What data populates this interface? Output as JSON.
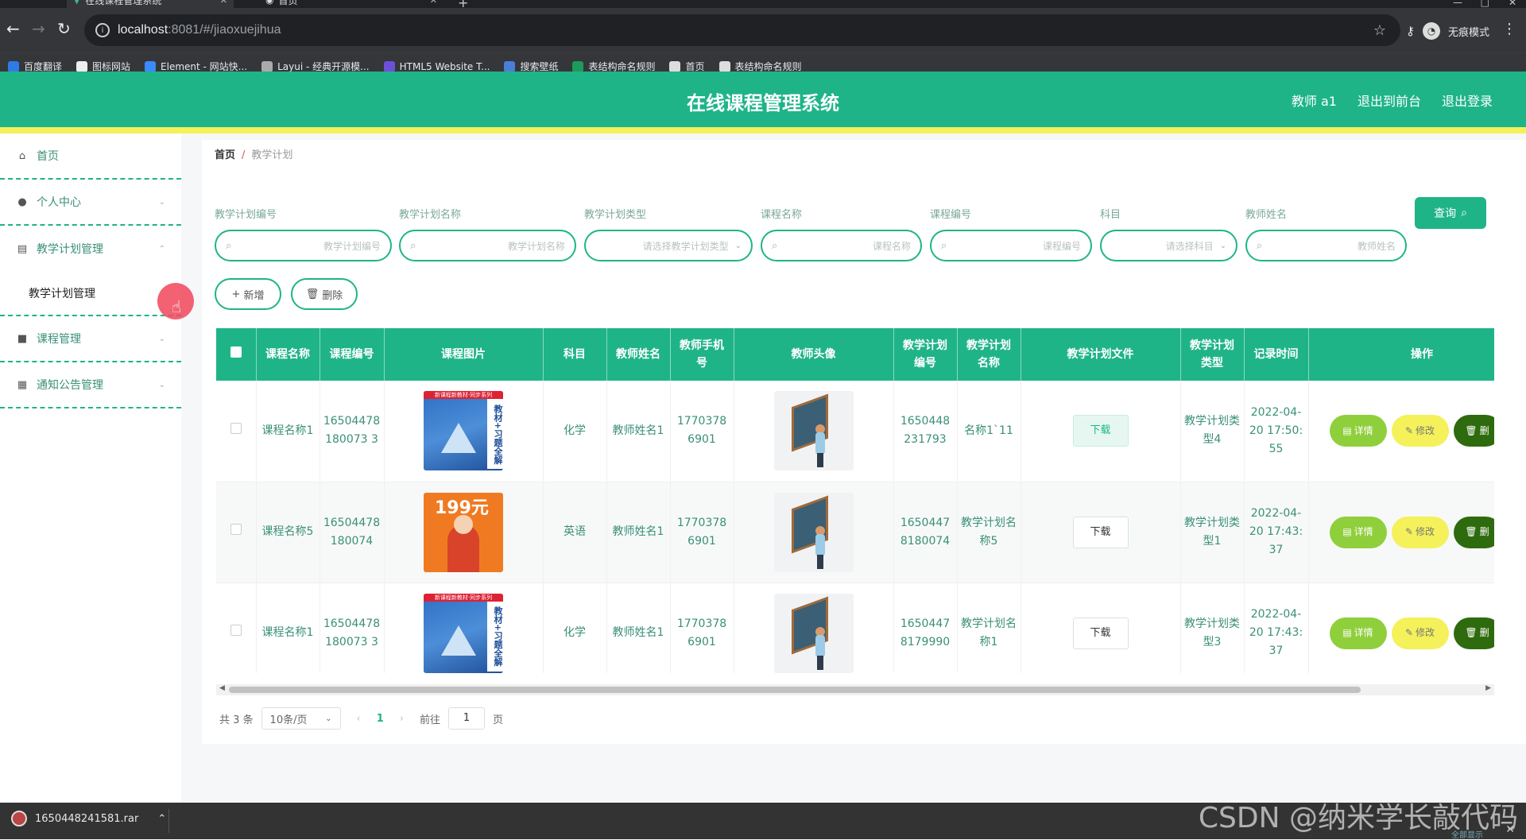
{
  "browser": {
    "tabs": [
      {
        "label": "在线课程管理系统",
        "close": "✕"
      },
      {
        "label": "首页",
        "close": "✕"
      }
    ],
    "url_host": "localhost",
    "url_rest": ":8081/#/jiaoxuejihua",
    "incognito_label": "无痕模式",
    "bookmarks": [
      {
        "label": "百度翻译",
        "color": "#2e7be8"
      },
      {
        "label": "图标网站",
        "color": "#eee"
      },
      {
        "label": "Element - 网站快...",
        "color": "#3b8bff"
      },
      {
        "label": "Layui - 经典开源模...",
        "color": "#aaa"
      },
      {
        "label": "HTML5 Website T...",
        "color": "#6e4fd8"
      },
      {
        "label": "搜索壁纸",
        "color": "#4a7fd8"
      },
      {
        "label": "表结构命名规则",
        "color": "#1d9b5b"
      },
      {
        "label": "首页",
        "color": "#ddd"
      },
      {
        "label": "表结构命名规则",
        "color": "#ddd"
      }
    ]
  },
  "header": {
    "title": "在线课程管理系统",
    "user": "教师 a1",
    "back_front": "退出到前台",
    "logout": "退出登录"
  },
  "sidebar": {
    "items": [
      {
        "label": "首页",
        "icon": "home-icon"
      },
      {
        "label": "个人中心",
        "icon": "user-icon"
      },
      {
        "label": "教学计划管理",
        "icon": "document-icon"
      },
      {
        "label": "课程管理",
        "icon": "video-icon"
      },
      {
        "label": "通知公告管理",
        "icon": "grid-icon"
      }
    ],
    "sub_item": "教学计划管理"
  },
  "breadcrumb": {
    "home": "首页",
    "sep": "/",
    "current": "教学计划"
  },
  "filters": [
    {
      "label": "教学计划编号",
      "placeholder": "教学计划编号"
    },
    {
      "label": "教学计划名称",
      "placeholder": "教学计划名称"
    },
    {
      "label": "教学计划类型",
      "placeholder": "请选择教学计划类型"
    },
    {
      "label": "课程名称",
      "placeholder": "课程名称"
    },
    {
      "label": "课程编号",
      "placeholder": "课程编号"
    },
    {
      "label": "科目",
      "placeholder": "请选择科目"
    },
    {
      "label": "教师姓名",
      "placeholder": "教师姓名"
    }
  ],
  "buttons": {
    "query": "查询",
    "add": "新增",
    "delete": "删除"
  },
  "table": {
    "headers": [
      "课程名称",
      "课程编号",
      "课程图片",
      "科目",
      "教师姓名",
      "教师手机号",
      "教师头像",
      "教学计划编号",
      "教学计划名称",
      "教学计划文件",
      "教学计划类型",
      "记录时间",
      "操作"
    ],
    "rows": [
      {
        "course_name": "课程名称1",
        "course_no": "16504478180073 3",
        "image": "book",
        "subject": "化学",
        "teacher": "教师姓名1",
        "phone": "17703786901",
        "plan_no": "1650448231793",
        "plan_name": "名称1`11",
        "file": "下载",
        "plan_type": "教学计划类型4",
        "time": "2022-04-20 17:50:55"
      },
      {
        "course_name": "课程名称5",
        "course_no": "16504478180074",
        "image": "orange",
        "subject": "英语",
        "teacher": "教师姓名1",
        "phone": "17703786901",
        "plan_no": "16504478180074",
        "plan_name": "教学计划名称5",
        "file": "下载",
        "plan_type": "教学计划类型1",
        "time": "2022-04-20 17:43:37"
      },
      {
        "course_name": "课程名称1",
        "course_no": "16504478180073 3",
        "image": "book",
        "subject": "化学",
        "teacher": "教师姓名1",
        "phone": "17703786901",
        "plan_no": "16504478179990",
        "plan_name": "教学计划名称1",
        "file": "下载",
        "plan_type": "教学计划类型3",
        "time": "2022-04-20 17:43:37"
      }
    ],
    "ops": {
      "detail": "详情",
      "edit": "修改",
      "delete": "删"
    }
  },
  "book_cover": {
    "top": "新课程新教材·同步系列",
    "spine": "教材+习题全解",
    "orange_title": "199元"
  },
  "pagination": {
    "total": "共 3 条",
    "page_size": "10条/页",
    "current": "1",
    "goto": "前往",
    "goto_value": "1",
    "page_unit": "页"
  },
  "taskbar": {
    "download": "1650448241581.rar",
    "show_all": "全部显示"
  },
  "watermark": "CSDN @纳米学长敲代码",
  "colors": {
    "primary": "#1fb488",
    "accent_yellow": "#f4f15a",
    "detail_green": "#8fcf3c",
    "delete_dark": "#2e6b0e"
  }
}
